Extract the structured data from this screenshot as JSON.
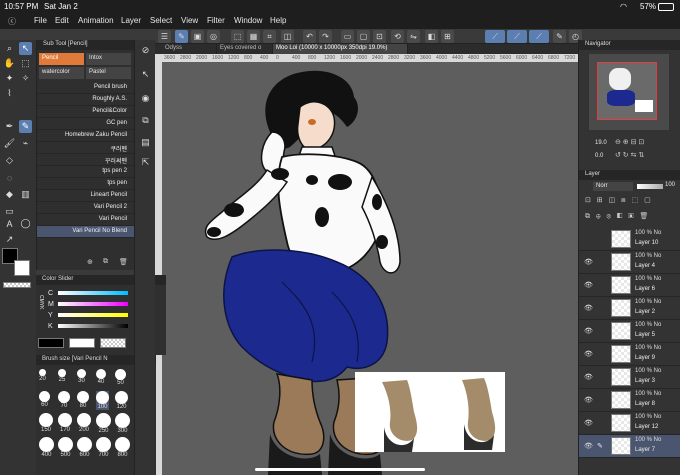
{
  "status": {
    "time": "10:57 PM",
    "date": "Sat Jan 2",
    "battery": "57%"
  },
  "menu": [
    "File",
    "Edit",
    "Animation",
    "Layer",
    "Select",
    "View",
    "Filter",
    "Window",
    "Help"
  ],
  "tabs": [
    {
      "label": "Odyss"
    },
    {
      "label": "Eyes covered o"
    },
    {
      "label": "Moo Loi (10000 x 10000px 350dpi 19.0%)"
    }
  ],
  "ruler_ticks": [
    "3600",
    "2800",
    "2000",
    "1600",
    "1200",
    "800",
    "400",
    "0",
    "400",
    "800",
    "1200",
    "1600",
    "2000",
    "2400",
    "2800",
    "3200",
    "3600",
    "4000",
    "4400",
    "4800",
    "5200",
    "5600",
    "6000",
    "6400",
    "6800",
    "7200"
  ],
  "subtool": {
    "header": "Sub Tool [Pencil]",
    "tabs": [
      "Pencil",
      "Intox",
      "watercolor",
      "Pastel"
    ],
    "brushes": [
      "Pencil brush",
      "Roughly A.S.",
      "Pencil&Color",
      "GC pen",
      "Homebrew Zaku Pencil",
      "쿠러펜",
      "꾸러써펜",
      "tps pen 2",
      "tps pen",
      "Lineart Pencil",
      "Vari Pencil 2",
      "Vari Pencil",
      "Vari Pencil No Blend"
    ]
  },
  "color_slider": {
    "header": "Color Slider",
    "labels": [
      "C",
      "M",
      "Y",
      "K"
    ],
    "values": [
      "0%",
      "0%",
      "0%",
      "0%"
    ],
    "mode": "CMYK"
  },
  "brush_size": {
    "header": "Brush size [Vari Pencil N",
    "sizes": [
      "20",
      "25",
      "30",
      "40",
      "50",
      "60",
      "70",
      "80",
      "100",
      "120",
      "150",
      "170",
      "200",
      "250",
      "300",
      "400",
      "500",
      "600",
      "700",
      "800"
    ]
  },
  "navigator": {
    "header": "Navigator",
    "zoom": "19.0",
    "rotation": "0.0"
  },
  "layers": {
    "header": "Layer",
    "blend": "Norr",
    "opacity": "100",
    "items": [
      {
        "opacity": "100 % No",
        "name": "Layer 10"
      },
      {
        "opacity": "100 % No",
        "name": "Layer 4"
      },
      {
        "opacity": "100 % No",
        "name": "Layer 6"
      },
      {
        "opacity": "100 % No",
        "name": "Layer 2"
      },
      {
        "opacity": "100 % No",
        "name": "Layer 5"
      },
      {
        "opacity": "100 % No",
        "name": "Layer 9"
      },
      {
        "opacity": "100 % No",
        "name": "Layer 3"
      },
      {
        "opacity": "100 % No",
        "name": "Layer 8"
      },
      {
        "opacity": "100 % No",
        "name": "Layer 12"
      },
      {
        "opacity": "100 % No",
        "name": "Layer 7"
      }
    ]
  },
  "colors": {
    "accent": "#5a7fb0",
    "main_color": "#000000",
    "sub_color": "#ffffff"
  }
}
